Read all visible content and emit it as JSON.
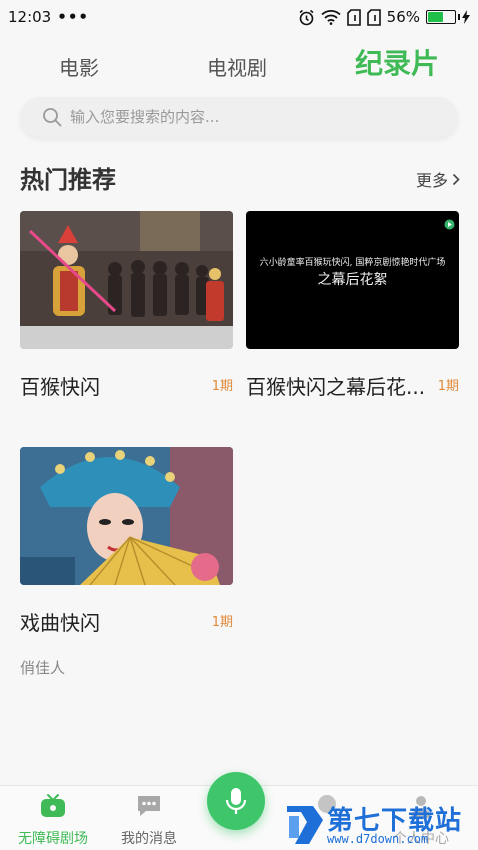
{
  "status_bar": {
    "time": "12:03",
    "dots": "•••",
    "battery_percent": "56%",
    "battery_level": 0.56
  },
  "tabs": [
    {
      "label": "电影"
    },
    {
      "label": "电视剧"
    },
    {
      "label": "纪录片",
      "active": true
    }
  ],
  "search": {
    "placeholder": "输入您要搜索的内容..."
  },
  "section": {
    "title": "热门推荐",
    "more_label": "更多"
  },
  "cards": [
    {
      "title": "百猴快闪",
      "episodes": "1期",
      "subtitle": ""
    },
    {
      "title": "百猴快闪之幕后花...",
      "episodes": "1期",
      "subtitle": "",
      "overlay_line1": "六小龄童率百猴玩快闪, 国粹京剧惊艳时代广场",
      "overlay_line2": "之幕后花絮"
    },
    {
      "title": "戏曲快闪",
      "episodes": "1期",
      "subtitle": "俏佳人"
    }
  ],
  "bottom_nav": [
    {
      "label": "无障碍剧场",
      "icon": "tv-icon",
      "active": true
    },
    {
      "label": "我的消息",
      "icon": "message-icon"
    },
    {
      "label": "mic",
      "icon": "mic-icon"
    },
    {
      "label": "...",
      "icon": "service-icon"
    },
    {
      "label": "个人中心",
      "icon": "person-icon"
    }
  ],
  "watermark": {
    "title": "第七下载站",
    "url": "www.d7down.com"
  },
  "colors": {
    "accent": "#3fba56",
    "episodes": "#e08a3a",
    "watermark": "#1e6fd8"
  }
}
